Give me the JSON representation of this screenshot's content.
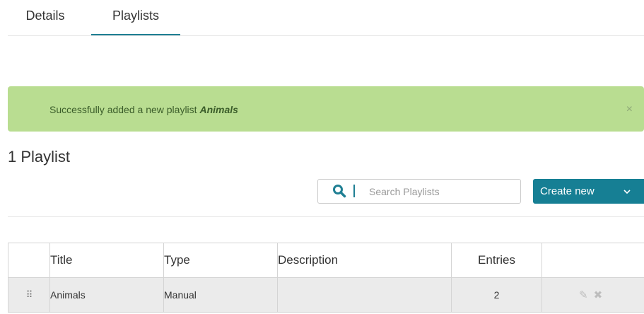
{
  "tabs": {
    "details": "Details",
    "playlists": "Playlists"
  },
  "alert": {
    "message_prefix": "Successfully added a new playlist ",
    "playlist_name": "Animals",
    "close": "×"
  },
  "heading": "1 Playlist",
  "search": {
    "placeholder": "Search Playlists",
    "value": ""
  },
  "create_button": {
    "label": "Create new",
    "caret": "⌄"
  },
  "table": {
    "headers": {
      "title": "Title",
      "type": "Type",
      "description": "Description",
      "entries": "Entries"
    },
    "rows": [
      {
        "title": "Animals",
        "type": "Manual",
        "description": "",
        "entries": "2"
      }
    ]
  },
  "colors": {
    "accent": "#167f94",
    "alert_bg": "#b9dd91"
  },
  "icons": {
    "search": "search-icon",
    "drag": "drag-handle-icon",
    "edit": "pencil-icon",
    "delete": "x-icon"
  }
}
